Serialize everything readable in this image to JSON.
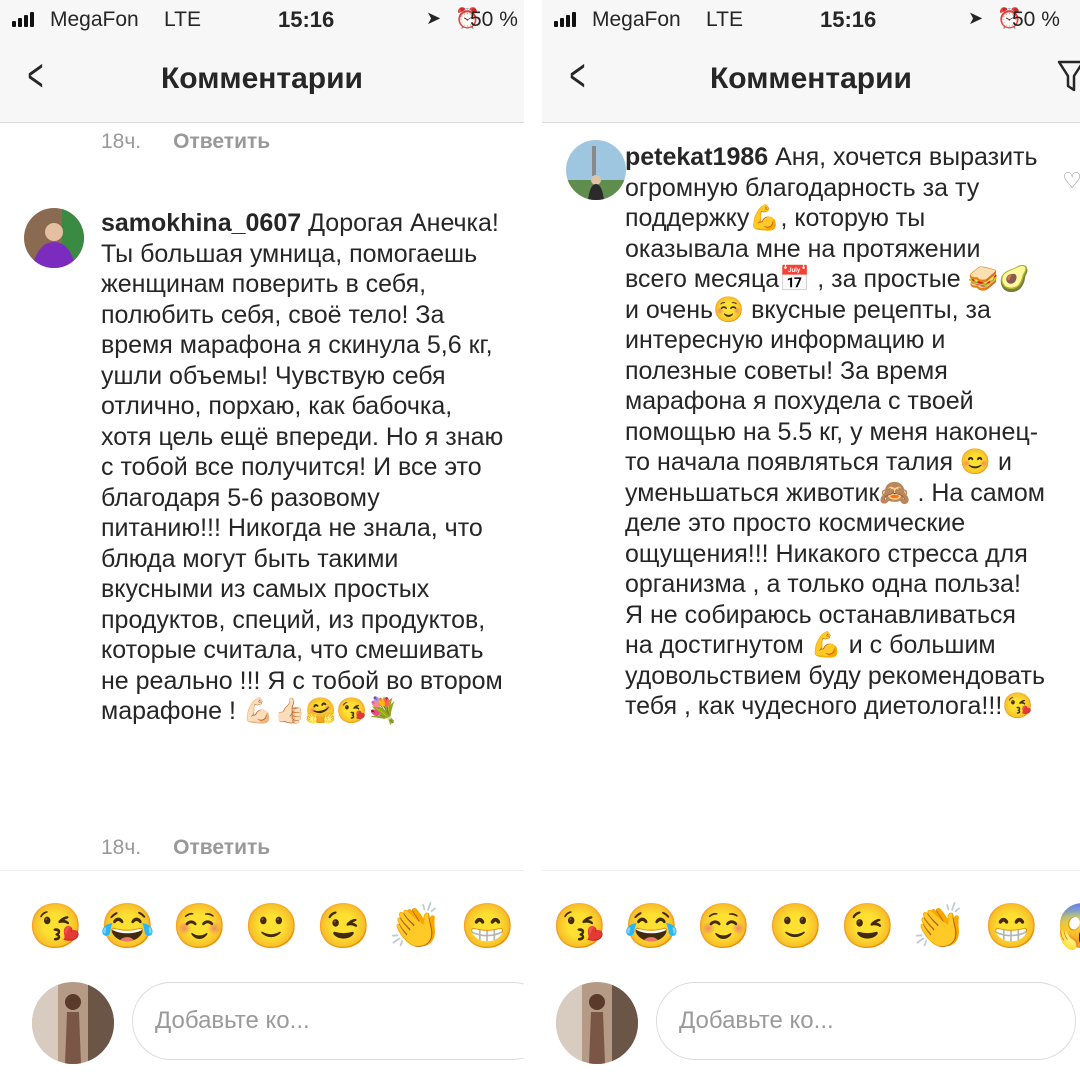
{
  "left": {
    "status": {
      "carrier": "MegaFon",
      "network": "LTE",
      "time": "15:16",
      "battery": "50 %"
    },
    "nav": {
      "title": "Комментарии"
    },
    "top_meta": {
      "time": "18ч.",
      "reply": "Ответить"
    },
    "comment": {
      "username": "samokhina_0607",
      "text": "Дорогая Анечка! Ты большая умница, помогаешь женщинам поверить в себя, полюбить себя, своё тело! За время марафона я скинула 5,6 кг, ушли объемы! Чувствую себя отлично, порхаю, как бабочка, хотя цель ещё впереди. Но я знаю с тобой все получится! И все это благодаря 5-6 разовому питанию!!! Никогда не знала, что блюда могут быть такими вкусными из самых простых продуктов, специй, из продуктов, которые считала, что смешивать не реально !!! Я с тобой во втором марафоне ! 💪🏻👍🏻🤗😘💐",
      "time": "18ч.",
      "reply": "Ответить"
    },
    "emoji_bar": [
      "😘",
      "😂",
      "☺️",
      "🙂",
      "😉",
      "👏",
      "😁"
    ],
    "composer": {
      "placeholder": "Добавьте ко..."
    }
  },
  "right": {
    "status": {
      "carrier": "MegaFon",
      "network": "LTE",
      "time": "15:16",
      "battery": "50 %"
    },
    "nav": {
      "title": "Комментарии"
    },
    "comment": {
      "username": "petekat1986",
      "text": "Аня, хочется выразить огромную благодарность  за ту поддержку💪, которую ты оказывала мне на протяжении всего месяца📅 , за простые 🥪🥑 и очень☺️ вкусные рецепты, за интересную информацию и полезные советы! За время марафона я похудела с твоей помощью на 5.5 кг, у меня наконец-то начала появляться талия 😊 и уменьшаться животик🙈 . На самом деле это просто космические ощущения!!! Никакого стресса для организма , а только одна польза! Я не собираюсь останавливаться на достигнутом 💪 и с большим удовольствием буду рекомендовать тебя , как чудесного диетолога!!!😘"
    },
    "emoji_bar": [
      "😘",
      "😂",
      "☺️",
      "🙂",
      "😉",
      "👏",
      "😁",
      "😱"
    ],
    "composer": {
      "placeholder": "Добавьте ко..."
    }
  },
  "icons": {
    "back": "chevron-left-icon",
    "filter": "filter-icon",
    "like": "heart-icon",
    "location": "location-arrow-icon",
    "alarm": "alarm-clock-icon",
    "signal": "cellular-signal-icon"
  }
}
